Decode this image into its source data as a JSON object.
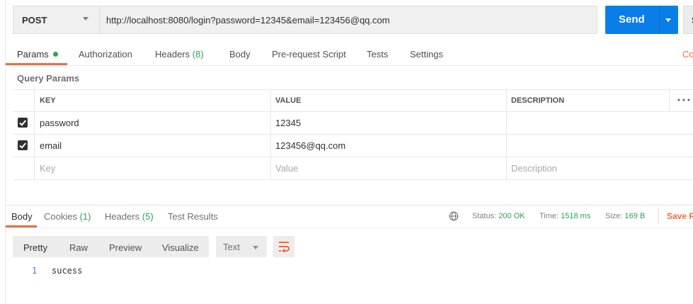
{
  "request": {
    "method": "POST",
    "url": "http://localhost:8080/login?password=12345&email=123456@qq.com",
    "send_label": "Send",
    "save_stub": "S"
  },
  "tabs": [
    {
      "label": "Params",
      "active": true,
      "has_dot": true
    },
    {
      "label": "Authorization"
    },
    {
      "label": "Headers",
      "count": "(8)"
    },
    {
      "label": "Body"
    },
    {
      "label": "Pre-request Script"
    },
    {
      "label": "Tests"
    },
    {
      "label": "Settings"
    }
  ],
  "cookies_link": "Co",
  "query_params": {
    "title": "Query Params",
    "headers": {
      "key": "KEY",
      "value": "VALUE",
      "description": "DESCRIPTION"
    },
    "rows": [
      {
        "checked": true,
        "key": "password",
        "value": "12345",
        "description": ""
      },
      {
        "checked": true,
        "key": "email",
        "value": "123456@qq.com",
        "description": ""
      }
    ],
    "placeholders": {
      "key": "Key",
      "value": "Value",
      "description": "Description"
    }
  },
  "response": {
    "tabs": [
      {
        "label": "Body",
        "active": true
      },
      {
        "label": "Cookies",
        "count": "(1)"
      },
      {
        "label": "Headers",
        "count": "(5)"
      },
      {
        "label": "Test Results"
      }
    ],
    "status_label": "Status:",
    "status_value": "200 OK",
    "time_label": "Time:",
    "time_value": "1518 ms",
    "size_label": "Size:",
    "size_value": "169 B",
    "save_label": "Save R",
    "view_buttons": [
      "Pretty",
      "Raw",
      "Preview",
      "Visualize"
    ],
    "format": "Text",
    "code_lines": [
      {
        "n": "1",
        "text": "sucess"
      }
    ]
  },
  "colors": {
    "accent": "#f26b3a",
    "send": "#0a7ee8",
    "success": "#2aa35a"
  }
}
